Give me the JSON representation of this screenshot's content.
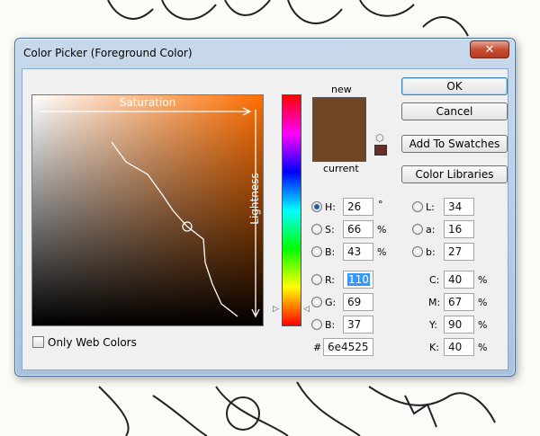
{
  "dialog": {
    "title": "Color Picker (Foreground Color)",
    "close_label": "✕"
  },
  "field": {
    "saturation_label": "Saturation",
    "lightness_label": "Lightness"
  },
  "swatch": {
    "new_label": "new",
    "current_label": "current",
    "color": "#6e4525",
    "gamut_color": "#6a2d2a"
  },
  "buttons": {
    "ok": "OK",
    "cancel": "Cancel",
    "add_to_swatches": "Add To Swatches",
    "color_libraries": "Color Libraries"
  },
  "hsb": {
    "h": {
      "label": "H:",
      "value": "26",
      "unit": "°",
      "checked": true
    },
    "s": {
      "label": "S:",
      "value": "66",
      "unit": "%"
    },
    "b": {
      "label": "B:",
      "value": "43",
      "unit": "%"
    }
  },
  "rgb": {
    "r": {
      "label": "R:",
      "value": "110"
    },
    "g": {
      "label": "G:",
      "value": "69"
    },
    "b": {
      "label": "B:",
      "value": "37"
    }
  },
  "lab": {
    "l": {
      "label": "L:",
      "value": "34"
    },
    "a": {
      "label": "a:",
      "value": "16"
    },
    "b": {
      "label": "b:",
      "value": "27"
    }
  },
  "cmyk": {
    "c": {
      "label": "C:",
      "value": "40",
      "unit": "%"
    },
    "m": {
      "label": "M:",
      "value": "67",
      "unit": "%"
    },
    "y": {
      "label": "Y:",
      "value": "90",
      "unit": "%"
    },
    "k": {
      "label": "K:",
      "value": "40",
      "unit": "%"
    }
  },
  "hex": {
    "label": "#",
    "value": "6e4525"
  },
  "web_colors": {
    "label": "Only Web Colors",
    "checked": false
  }
}
